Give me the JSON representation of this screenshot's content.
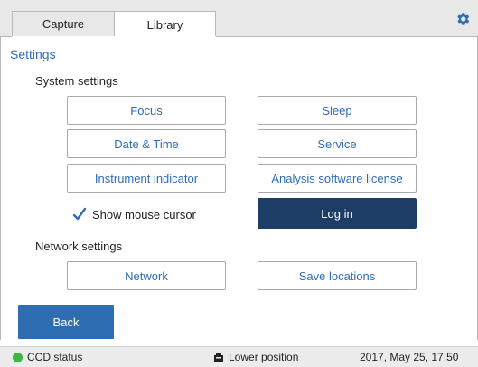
{
  "tabs": [
    {
      "label": "Capture",
      "active": false
    },
    {
      "label": "Library",
      "active": true
    }
  ],
  "settings_icon": "gear-icon",
  "page_title": "Settings",
  "system_settings": {
    "label": "System settings",
    "buttons": {
      "focus": "Focus",
      "sleep": "Sleep",
      "date_time": "Date & Time",
      "service": "Service",
      "instrument_indicator": "Instrument indicator",
      "analysis_license": "Analysis software license",
      "log_in": "Log in"
    },
    "show_mouse_cursor": {
      "label": "Show mouse cursor",
      "checked": true
    }
  },
  "network_settings": {
    "label": "Network settings",
    "buttons": {
      "network": "Network",
      "save_locations": "Save locations"
    }
  },
  "back_label": "Back",
  "status_bar": {
    "ccd_status": "CCD status",
    "ccd_status_color": "#3fb63f",
    "position": "Lower position",
    "datetime": "2017, May 25, 17:50"
  },
  "colors": {
    "accent": "#2f6db3",
    "dark_button": "#1e3d66"
  }
}
